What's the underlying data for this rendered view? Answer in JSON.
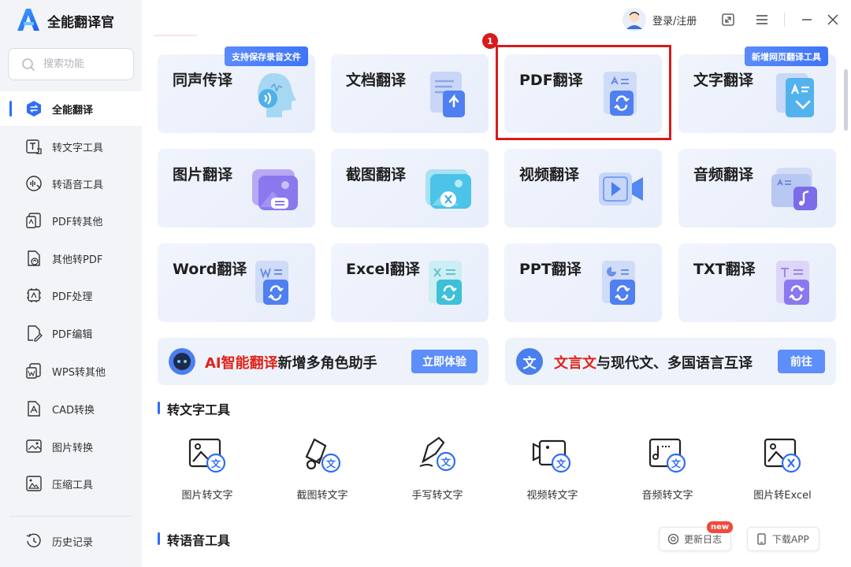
{
  "app": {
    "title": "全能翻译官"
  },
  "search": {
    "placeholder": "搜索功能"
  },
  "sidebar": {
    "items": [
      {
        "label": "全能翻译",
        "icon": "swap-icon",
        "active": true
      },
      {
        "label": "转文字工具",
        "icon": "text-convert-icon"
      },
      {
        "label": "转语音工具",
        "icon": "voice-icon"
      },
      {
        "label": "PDF转其他",
        "icon": "pdf-export-icon"
      },
      {
        "label": "其他转PDF",
        "icon": "pdf-import-icon"
      },
      {
        "label": "PDF处理",
        "icon": "pdf-process-icon"
      },
      {
        "label": "PDF编辑",
        "icon": "pdf-edit-icon"
      },
      {
        "label": "WPS转其他",
        "icon": "wps-icon"
      },
      {
        "label": "CAD转换",
        "icon": "cad-icon"
      },
      {
        "label": "图片转换",
        "icon": "image-convert-icon"
      },
      {
        "label": "压缩工具",
        "icon": "compress-icon"
      }
    ],
    "history": {
      "label": "历史记录",
      "icon": "history-icon"
    }
  },
  "topbar": {
    "login": "登录/注册"
  },
  "cards": [
    {
      "title": "同声传译",
      "icon": "head-audio-icon"
    },
    {
      "title": "文档翻译",
      "icon": "document-icon"
    },
    {
      "title": "PDF翻译",
      "icon": "pdf-translate-icon"
    },
    {
      "title": "文字翻译",
      "icon": "text-translate-icon"
    },
    {
      "title": "图片翻译",
      "icon": "image-icon"
    },
    {
      "title": "截图翻译",
      "icon": "screenshot-icon"
    },
    {
      "title": "视频翻译",
      "icon": "video-icon"
    },
    {
      "title": "音频翻译",
      "icon": "audio-icon"
    },
    {
      "title": "Word翻译",
      "icon": "word-icon"
    },
    {
      "title": "Excel翻译",
      "icon": "excel-icon"
    },
    {
      "title": "PPT翻译",
      "icon": "ppt-icon"
    },
    {
      "title": "TXT翻译",
      "icon": "txt-icon"
    }
  ],
  "badges": {
    "simultaneous": "支持保存录音文件",
    "text": "新增网页翻译工具"
  },
  "step_marker": "1",
  "banners": [
    {
      "highlight": "AI智能翻译",
      "rest": "新增多角色助手",
      "button": "立即体验",
      "icon": "robot-icon"
    },
    {
      "highlight": "文言文",
      "rest": "与现代文、多国语言互译",
      "button": "前往",
      "icon": "wen-icon",
      "icon_char": "文"
    }
  ],
  "sections": {
    "text_tools": "转文字工具",
    "voice_tools": "转语音工具"
  },
  "tools": [
    {
      "label": "图片转文字",
      "icon": "image-to-text-icon"
    },
    {
      "label": "截图转文字",
      "icon": "screenshot-to-text-icon"
    },
    {
      "label": "手写转文字",
      "icon": "handwriting-to-text-icon"
    },
    {
      "label": "视频转文字",
      "icon": "video-to-text-icon"
    },
    {
      "label": "音频转文字",
      "icon": "audio-to-text-icon"
    },
    {
      "label": "图片转Excel",
      "icon": "image-to-excel-icon"
    }
  ],
  "float": {
    "changelog": "更新日志",
    "new_tag": "new",
    "download": "下载APP"
  },
  "colors": {
    "accent": "#2f6df6",
    "highlight_red": "#d81b1b",
    "badge_blue": "#4a7ef8",
    "button_blue": "#5d8ef9"
  }
}
